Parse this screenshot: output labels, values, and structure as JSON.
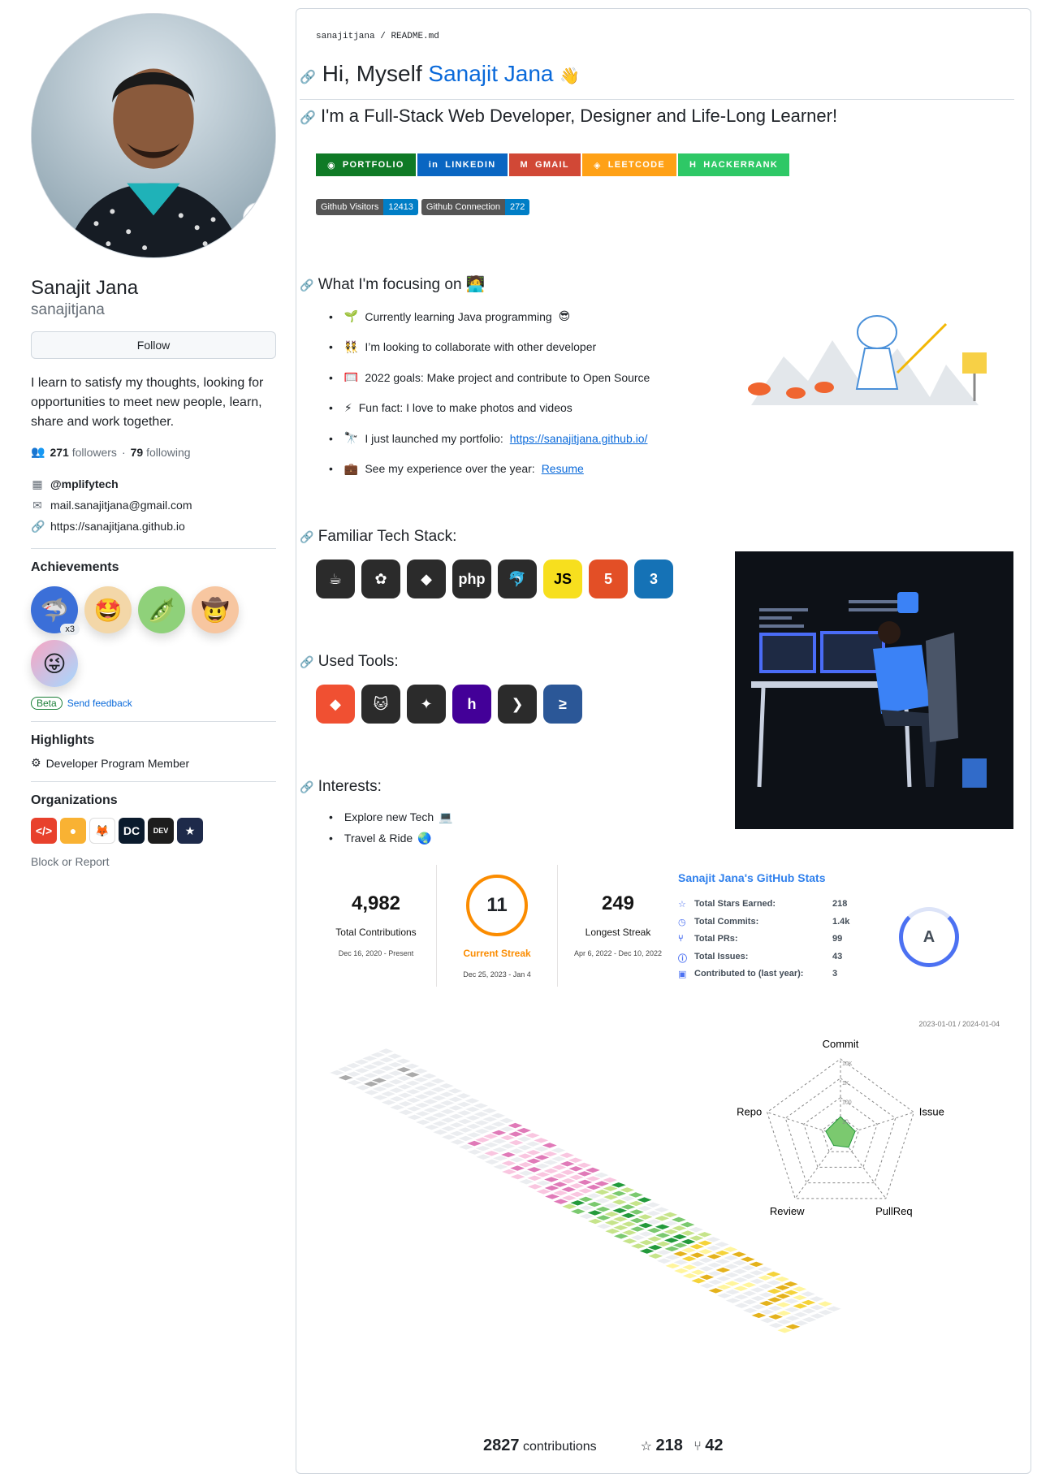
{
  "profile": {
    "fullname": "Sanajit Jana",
    "username": "sanajitjana",
    "follow_label": "Follow",
    "bio": "I learn to satisfy my thoughts, looking for opportunities to meet new people, learn, share and work together.",
    "followers": "271",
    "followers_label": "followers",
    "following": "79",
    "following_label": "following",
    "company": "@mplifytech",
    "email": "mail.sanajitjana@gmail.com",
    "website": "https://sanajitjana.github.io",
    "achievements_title": "Achievements",
    "achievement_count": "x3",
    "beta_label": "Beta",
    "feedback_label": "Send feedback",
    "highlights_title": "Highlights",
    "highlight_item": "Developer Program Member",
    "orgs_title": "Organizations",
    "block_label": "Block or Report"
  },
  "readme": {
    "crumb_user": "sanajitjana",
    "crumb_file": "README.md",
    "greet_prefix": "Hi, Myself",
    "greet_name": "Sanajit Jana",
    "greet_emoji": "👋",
    "tagline": "I'm a Full-Stack Web Developer, Designer and Life-Long Learner!",
    "social": [
      {
        "label": "PORTFOLIO",
        "color": "#0f7a26"
      },
      {
        "label": "LINKEDIN",
        "color": "#0a66c2"
      },
      {
        "label": "GMAIL",
        "color": "#d14836"
      },
      {
        "label": "LEETCODE",
        "color": "#ffa116"
      },
      {
        "label": "HACKERRANK",
        "color": "#2ec866"
      }
    ],
    "visitors_label": "Github Visitors",
    "visitors_value": "12413",
    "connection_label": "Github Connection",
    "connection_value": "272",
    "focus_title": "What I'm focusing on",
    "focus": [
      {
        "emoji": "🌱",
        "text": "Currently learning Java programming",
        "suffix": "😎"
      },
      {
        "emoji": "👯",
        "text": "I’m looking to collaborate with other developer",
        "suffix": ""
      },
      {
        "emoji": "🥅",
        "text": "2022 goals: Make project and contribute to Open Source",
        "suffix": ""
      },
      {
        "emoji": "⚡",
        "text": "Fun fact: I love to make photos and videos",
        "suffix": ""
      },
      {
        "emoji": "🔭",
        "text": "I just launched my portfolio:",
        "link": "https://sanajitjana.github.io/"
      },
      {
        "emoji": "💼",
        "text": "See my experience over the year:",
        "link": "Resume"
      }
    ],
    "tech_title": "Familiar Tech Stack:",
    "tech": [
      {
        "name": "java-icon",
        "glyph": "☕",
        "color": "#2b2b2b"
      },
      {
        "name": "spring-icon",
        "glyph": "✿",
        "color": "#2b2b2b"
      },
      {
        "name": "hibernate-icon",
        "glyph": "◆",
        "color": "#2b2b2b"
      },
      {
        "name": "php-icon",
        "glyph": "php",
        "color": "#2b2b2b"
      },
      {
        "name": "mysql-icon",
        "glyph": "🐬",
        "color": "#2b2b2b"
      },
      {
        "name": "javascript-icon",
        "glyph": "JS",
        "color": "#f7df1e"
      },
      {
        "name": "html5-icon",
        "glyph": "5",
        "color": "#e34f26"
      },
      {
        "name": "css3-icon",
        "glyph": "3",
        "color": "#1572b6"
      }
    ],
    "tools_title": "Used Tools:",
    "tools": [
      {
        "name": "git-icon",
        "glyph": "◆",
        "color": "#f05032"
      },
      {
        "name": "github-icon",
        "glyph": "🐱",
        "color": "#2b2b2b"
      },
      {
        "name": "netlify-icon",
        "glyph": "✦",
        "color": "#2b2b2b"
      },
      {
        "name": "heroku-icon",
        "glyph": "h",
        "color": "#430098"
      },
      {
        "name": "vscode-icon",
        "glyph": "❯",
        "color": "#2b2b2b"
      },
      {
        "name": "powershell-icon",
        "glyph": "≥",
        "color": "#2b5797"
      }
    ],
    "interests_title": "Interests:",
    "interests": [
      {
        "text": "Explore new Tech",
        "emoji": "💻"
      },
      {
        "text": "Travel & Ride",
        "emoji": "🌏"
      }
    ]
  },
  "streak": {
    "total": "4,982",
    "total_label": "Total Contributions",
    "total_range": "Dec 16, 2020 - Present",
    "current": "11",
    "current_label": "Current Streak",
    "current_range": "Dec 25, 2023 - Jan 4",
    "longest": "249",
    "longest_label": "Longest Streak",
    "longest_range": "Apr 6, 2022 - Dec 10, 2022"
  },
  "gh_stats": {
    "title": "Sanajit Jana's GitHub Stats",
    "rows": [
      {
        "label": "Total Stars Earned:",
        "value": "218",
        "icon": "☆"
      },
      {
        "label": "Total Commits:",
        "value": "1.4k",
        "icon": "◷"
      },
      {
        "label": "Total PRs:",
        "value": "99",
        "icon": "⑂"
      },
      {
        "label": "Total Issues:",
        "value": "43",
        "icon": "ⓘ"
      },
      {
        "label": "Contributed to (last year):",
        "value": "3",
        "icon": "▣"
      }
    ],
    "grade": "A"
  },
  "contrib3d": {
    "range": "2023-01-01 / 2024-01-04",
    "radar_labels": [
      "Commit",
      "Issue",
      "PullReq",
      "Review",
      "Repo"
    ],
    "radar_ticks": [
      "10K",
      "1K",
      "100",
      "10"
    ],
    "contributions": "2827",
    "contributions_label": "contributions",
    "stars": "218",
    "forks": "42"
  }
}
